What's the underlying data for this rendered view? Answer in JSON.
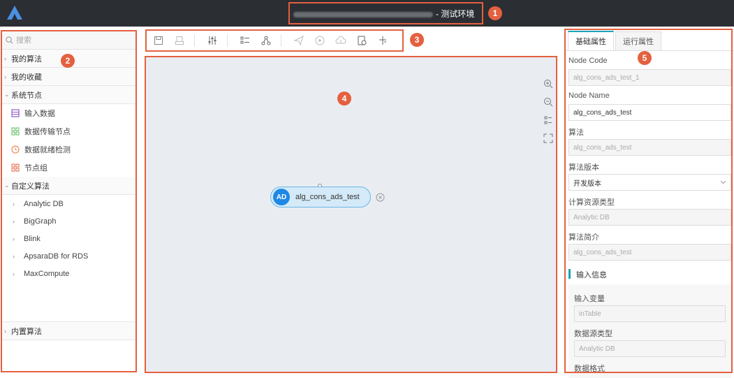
{
  "header": {
    "env_suffix": "- 测试环境"
  },
  "sidebar": {
    "search_placeholder": "搜索",
    "groups": {
      "my_algorithms": "我的算法",
      "my_favorites": "我的收藏",
      "system_nodes": "系统节点",
      "custom_algorithms": "自定义算法",
      "builtin_algorithms": "内置算法"
    },
    "system_items": [
      "输入数据",
      "数据传输节点",
      "数据就绪检测",
      "节点组"
    ],
    "custom_items": [
      "Analytic DB",
      "BigGraph",
      "Blink",
      "ApsaraDB for RDS",
      "MaxCompute"
    ]
  },
  "canvas": {
    "node": {
      "badge": "AD",
      "label": "alg_cons_ads_test"
    }
  },
  "panel": {
    "tabs": [
      "基础属性",
      "运行属性"
    ],
    "node_code_label": "Node Code",
    "node_code_value": "alg_cons_ads_test_1",
    "node_name_label": "Node Name",
    "node_name_value": "alg_cons_ads_test",
    "algorithm_label": "算法",
    "algorithm_value": "alg_cons_ads_test",
    "version_label": "算法版本",
    "version_value": "开发版本",
    "resource_label": "计算资源类型",
    "resource_value": "Analytic DB",
    "intro_label": "算法简介",
    "intro_value": "alg_cons_ads_test",
    "input_section": "输入信息",
    "input_var_label": "输入变量",
    "input_var_value": "inTable",
    "datasource_label": "数据源类型",
    "datasource_value": "Analytic DB",
    "format_label": "数据格式"
  },
  "annotations": [
    "1",
    "2",
    "3",
    "4",
    "5"
  ],
  "colors": {
    "accent": "#1aa3b8",
    "highlight": "#e4603f",
    "topbar": "#2b2e33",
    "node_badge": "#1e88e5"
  }
}
